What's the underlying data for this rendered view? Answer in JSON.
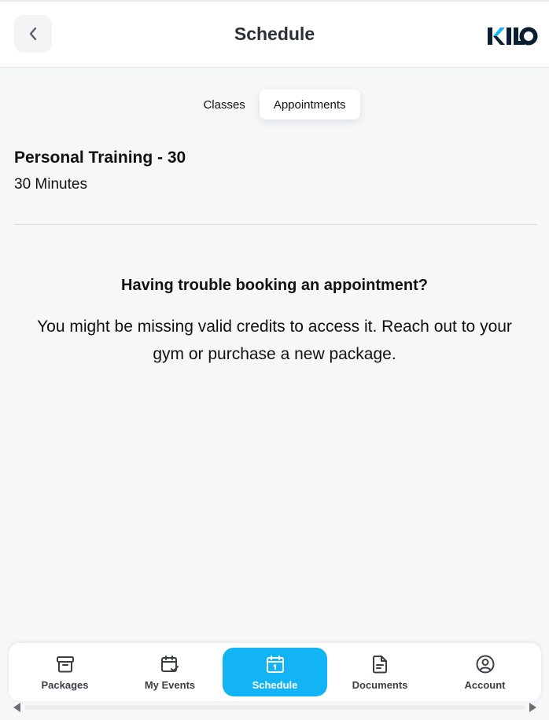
{
  "header": {
    "title": "Schedule",
    "logo_text": "KILO",
    "back_icon": "chevron-left-icon"
  },
  "tabs": [
    {
      "label": "Classes",
      "active": false
    },
    {
      "label": "Appointments",
      "active": true
    }
  ],
  "appointment": {
    "title": "Personal Training - 30",
    "duration": "30 Minutes"
  },
  "notice": {
    "heading": "Having trouble booking an appointment?",
    "body": "You might be missing valid credits to access it. Reach out to your gym or purchase a new package."
  },
  "bottom_nav": {
    "items": [
      {
        "label": "Packages",
        "icon": "archive-box-icon",
        "active": false
      },
      {
        "label": "My Events",
        "icon": "calendar-check-icon",
        "active": false
      },
      {
        "label": "Schedule",
        "icon": "calendar-icon",
        "active": true
      },
      {
        "label": "Documents",
        "icon": "document-icon",
        "active": false
      },
      {
        "label": "Account",
        "icon": "user-circle-icon",
        "active": false
      }
    ]
  },
  "colors": {
    "accent": "#13b4f5",
    "background": "#f6f7f9",
    "logo_dark": "#0b1f33",
    "logo_accent": "#13b4f5"
  }
}
